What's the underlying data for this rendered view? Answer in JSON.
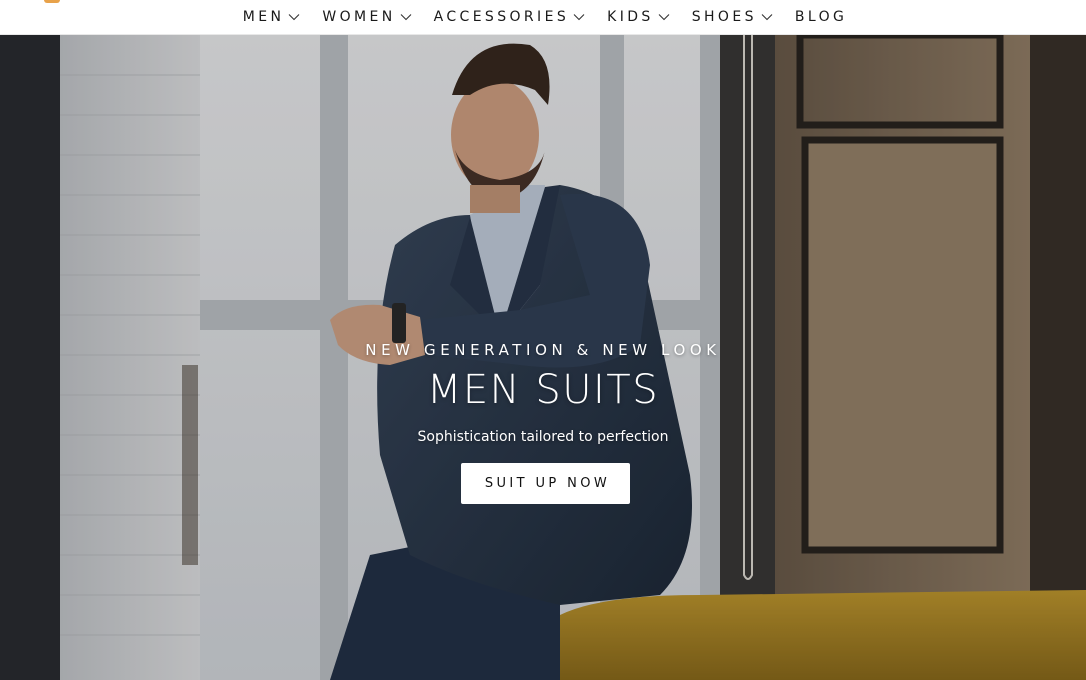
{
  "nav": {
    "items": [
      {
        "label": "MEN",
        "has_dropdown": true
      },
      {
        "label": "WOMEN",
        "has_dropdown": true
      },
      {
        "label": "ACCESSORIES",
        "has_dropdown": true
      },
      {
        "label": "KIDS",
        "has_dropdown": true
      },
      {
        "label": "SHOES",
        "has_dropdown": true
      },
      {
        "label": "BLOG",
        "has_dropdown": false
      }
    ],
    "chevron_icon": "chevron-down-icon"
  },
  "hero": {
    "kicker": "NEW GENERATION & NEW LOOK",
    "title": "MEN SUITS",
    "subtitle": "Sophistication tailored to perfection",
    "cta_label": "SUIT UP NOW",
    "image": "man-in-navy-suit-by-window"
  },
  "colors": {
    "nav_bg": "#ffffff",
    "nav_text": "#1a1a1a",
    "hero_text": "#ffffff",
    "cta_bg": "#ffffff",
    "cta_text": "#111111",
    "suit": "#2c3a4d",
    "sofa": "#b58f2a",
    "wall": "#8f7a62",
    "logo_accent": "#e8a24a"
  }
}
